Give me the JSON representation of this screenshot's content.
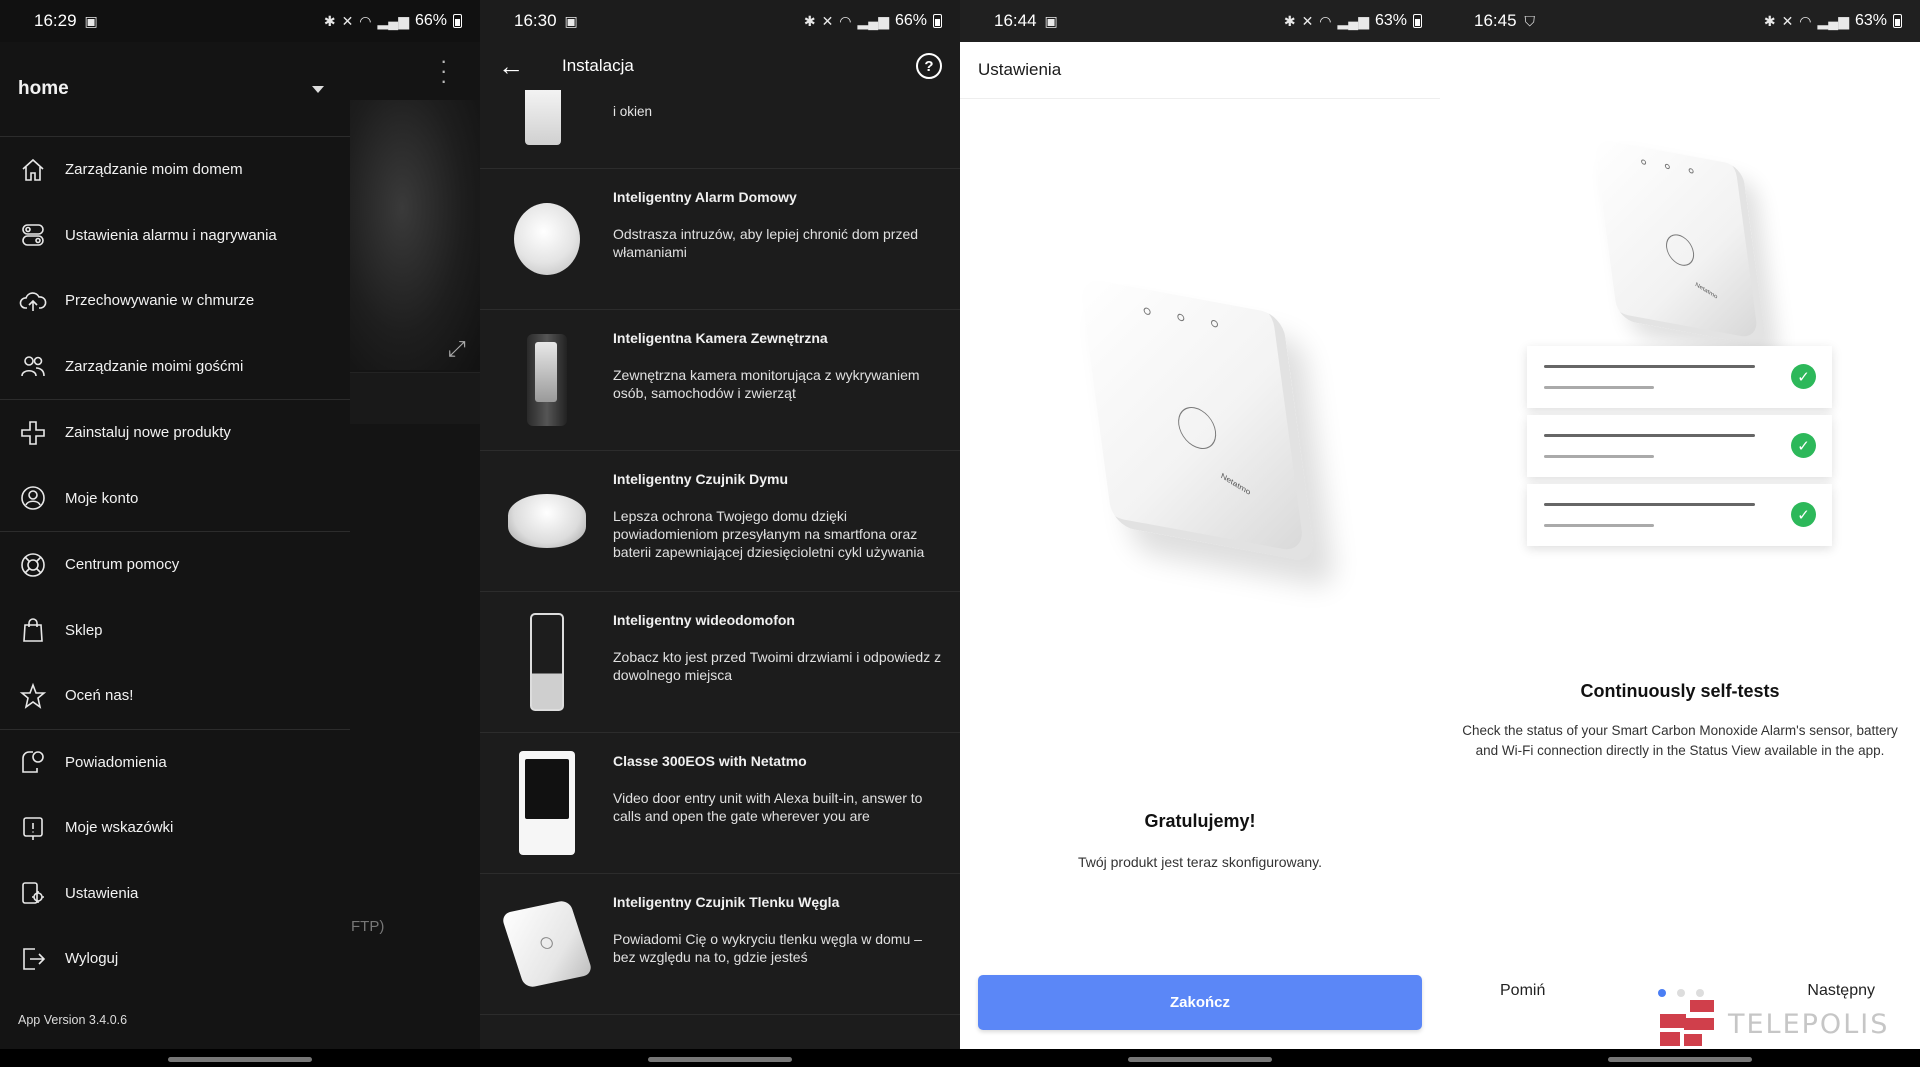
{
  "panel1": {
    "status": {
      "time": "16:29",
      "battery": "66%"
    },
    "drawer_title": "home",
    "menu_groups": [
      [
        {
          "label": "Zarządzanie moim domem",
          "icon": "home-icon"
        },
        {
          "label": "Ustawienia alarmu i nagrywania",
          "icon": "alarm-settings-icon"
        },
        {
          "label": "Przechowywanie w chmurze",
          "icon": "cloud-upload-icon"
        },
        {
          "label": "Zarządzanie moimi gośćmi",
          "icon": "guests-icon"
        }
      ],
      [
        {
          "label": "Zainstaluj nowe produkty",
          "icon": "plus-icon"
        },
        {
          "label": "Moje konto",
          "icon": "account-icon"
        }
      ],
      [
        {
          "label": "Centrum pomocy",
          "icon": "lifebuoy-icon"
        },
        {
          "label": "Sklep",
          "icon": "shopping-bag-icon"
        },
        {
          "label": "Oceń nas!",
          "icon": "star-icon"
        }
      ],
      [
        {
          "label": "Powiadomienia",
          "icon": "notifications-icon"
        },
        {
          "label": "Moje wskazówki",
          "icon": "tips-icon"
        },
        {
          "label": "Ustawienia",
          "icon": "settings-icon"
        },
        {
          "label": "Wyloguj",
          "icon": "logout-icon"
        }
      ]
    ],
    "app_version": "App Version 3.4.0.6",
    "background_partial_text": "FTP)"
  },
  "panel2": {
    "status": {
      "time": "16:30",
      "battery": "66%"
    },
    "header_title": "Instalacja",
    "help_label": "?",
    "partial_item_text": "i okien",
    "products": [
      {
        "name": "Inteligentny Alarm Domowy",
        "desc": "Odstrasza intruzów, aby lepiej chronić dom przed włamaniami",
        "thumb": "round"
      },
      {
        "name": "Inteligentna Kamera Zewnętrzna",
        "desc": "Zewnętrzna kamera monitorująca z wykrywaniem osób, samochodów i zwierząt",
        "thumb": "cam"
      },
      {
        "name": "Inteligentny Czujnik Dymu",
        "desc": "Lepsza ochrona Twojego domu dzięki powiadomieniom przesyłanym na smartfona oraz baterii zapewniającej dziesięcioletni cykl używania",
        "thumb": "smoke"
      },
      {
        "name": "Inteligentny wideodomofon",
        "desc": "Zobacz kto jest przed Twoimi drzwiami i odpowiedz z dowolnego miejsca",
        "thumb": "door"
      },
      {
        "name": "Classe 300EOS with Netatmo",
        "desc": "Video door entry unit with Alexa built-in, answer to calls and open the gate wherever you are",
        "thumb": "panel"
      },
      {
        "name": "Inteligentny Czujnik Tlenku Węgla",
        "desc": "Powiadomi Cię o wykryciu tlenku węgla w domu – bez względu na to, gdzie jesteś",
        "thumb": "co"
      }
    ]
  },
  "panel3": {
    "status": {
      "time": "16:44",
      "battery": "63%"
    },
    "header_title": "Ustawienia",
    "device_brand": "Netatmo",
    "title": "Gratulujemy!",
    "text": "Twój produkt jest teraz skonfigurowany.",
    "finish_label": "Zakończ"
  },
  "panel4": {
    "status": {
      "time": "16:45",
      "battery": "63%"
    },
    "device_brand": "Netatmo",
    "title": "Continuously self-tests",
    "text": "Check the status of your Smart Carbon Monoxide Alarm's sensor, battery and Wi-Fi connection directly in the Status View available in the app.",
    "skip_label": "Pomiń",
    "next_label": "Następny",
    "watermark": "TELEPOLIS",
    "pager": {
      "count": 3,
      "active": 0
    }
  },
  "colors": {
    "accent_blue": "#5b87f7",
    "check_green": "#2db85a",
    "dark_bg": "#1c1c1c"
  }
}
